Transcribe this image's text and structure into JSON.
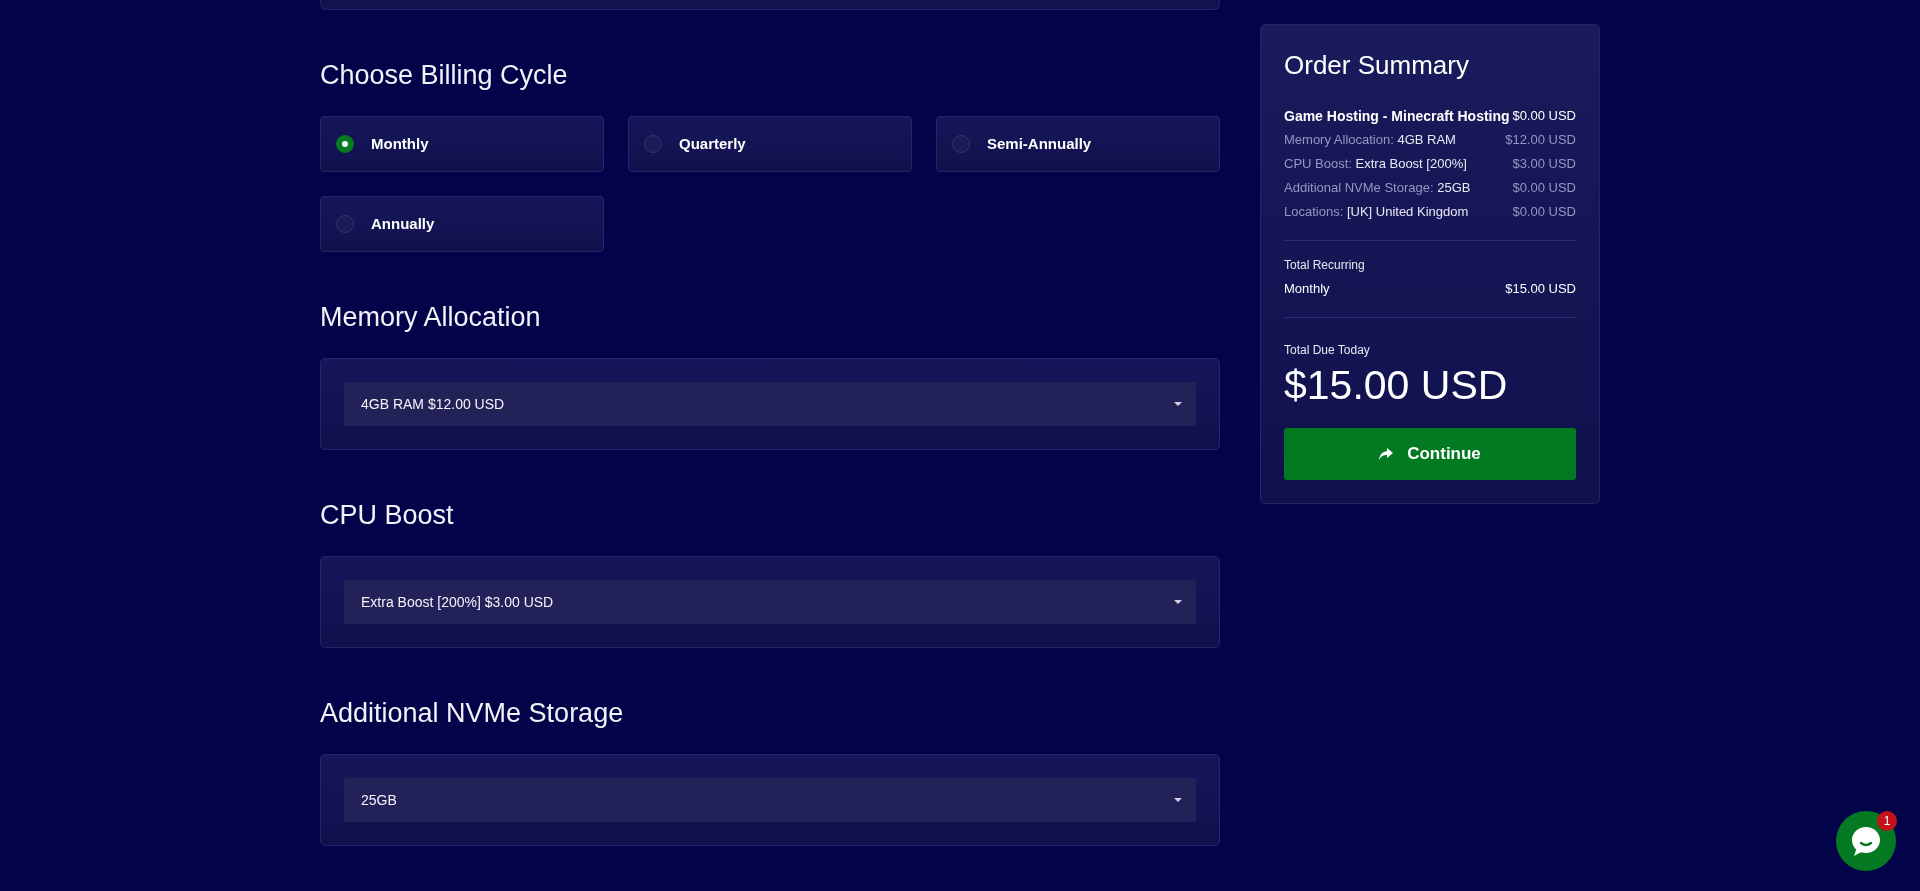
{
  "billing_cycle": {
    "title": "Choose Billing Cycle",
    "options": [
      {
        "label": "Monthly",
        "selected": true
      },
      {
        "label": "Quarterly",
        "selected": false
      },
      {
        "label": "Semi-Annually",
        "selected": false
      },
      {
        "label": "Annually",
        "selected": false
      }
    ]
  },
  "config_options": [
    {
      "title": "Memory Allocation",
      "value": "4GB RAM $12.00 USD"
    },
    {
      "title": "CPU Boost",
      "value": "Extra Boost [200%] $3.00 USD"
    },
    {
      "title": "Additional NVMe Storage",
      "value": "25GB"
    }
  ],
  "order_summary": {
    "title": "Order Summary",
    "product": {
      "name": "Game Hosting - Minecraft Hosting",
      "price": "$0.00 USD"
    },
    "items": [
      {
        "label": "Memory Allocation:",
        "value": "4GB RAM",
        "price": "$12.00 USD"
      },
      {
        "label": "CPU Boost:",
        "value": "Extra Boost [200%]",
        "price": "$3.00 USD"
      },
      {
        "label": "Additional NVMe Storage:",
        "value": "25GB",
        "price": "$0.00 USD"
      },
      {
        "label": "Locations:",
        "value": "[UK] United Kingdom",
        "price": "$0.00 USD"
      }
    ],
    "recurring": {
      "label": "Total Recurring",
      "cycle": "Monthly",
      "price": "$15.00 USD"
    },
    "due": {
      "label": "Total Due Today",
      "amount": "$15.00 USD"
    },
    "button": {
      "label": "Continue"
    }
  },
  "chat": {
    "badge": "1"
  }
}
